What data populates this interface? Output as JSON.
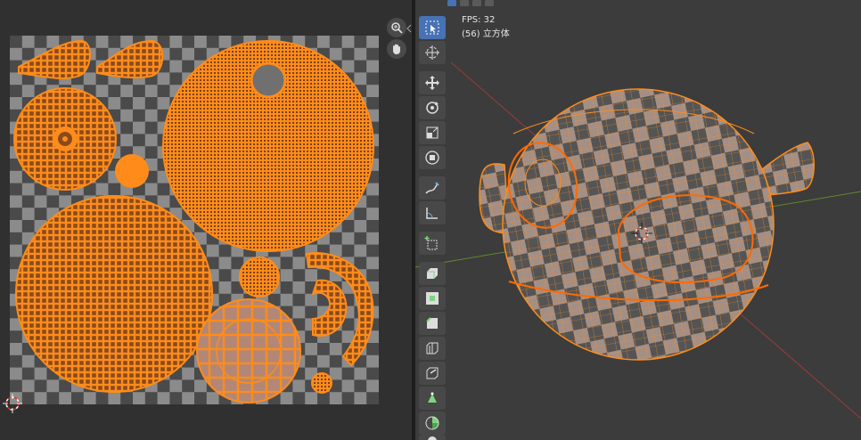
{
  "uv_editor": {
    "tools": [
      {
        "name": "zoom",
        "icon": "zoom-icon"
      },
      {
        "name": "pan",
        "icon": "hand-icon"
      }
    ],
    "cursor_icon": "2d-cursor-icon"
  },
  "viewport": {
    "overlay": {
      "fps_label": "FPS: 32",
      "object_label": "(56) 立方体"
    },
    "header_modes": [
      "vertex-select",
      "edge-select",
      "face-select",
      "island-select"
    ],
    "toolbar": [
      {
        "name": "select-box",
        "icon": "select-box-icon",
        "active": true
      },
      {
        "name": "cursor",
        "icon": "cursor-icon",
        "active": false
      },
      {
        "name": "move",
        "icon": "move-icon",
        "active": false
      },
      {
        "name": "rotate",
        "icon": "rotate-icon",
        "active": false
      },
      {
        "name": "scale",
        "icon": "scale-icon",
        "active": false
      },
      {
        "name": "transform",
        "icon": "transform-icon",
        "active": false
      },
      {
        "name": "annotate",
        "icon": "annotate-icon",
        "active": false
      },
      {
        "name": "measure",
        "icon": "measure-icon",
        "active": false
      },
      {
        "name": "add-cube",
        "icon": "add-cube-icon",
        "active": false
      },
      {
        "name": "extrude",
        "icon": "extrude-icon",
        "active": false
      },
      {
        "name": "inset",
        "icon": "inset-icon",
        "active": false
      },
      {
        "name": "bevel",
        "icon": "bevel-icon",
        "active": false
      },
      {
        "name": "loop-cut",
        "icon": "loop-cut-icon",
        "active": false
      },
      {
        "name": "knife",
        "icon": "knife-icon",
        "active": false
      },
      {
        "name": "poly-build",
        "icon": "poly-build-icon",
        "active": false
      },
      {
        "name": "spin",
        "icon": "spin-icon",
        "active": false
      }
    ]
  },
  "colors": {
    "selection": "#ff8c1a",
    "uv_bg": "#303030",
    "viewport_bg": "#3c3c3c",
    "tool_active": "#4772b3",
    "axis_x": "#9a3b3b",
    "axis_y": "#5d8a2e"
  }
}
